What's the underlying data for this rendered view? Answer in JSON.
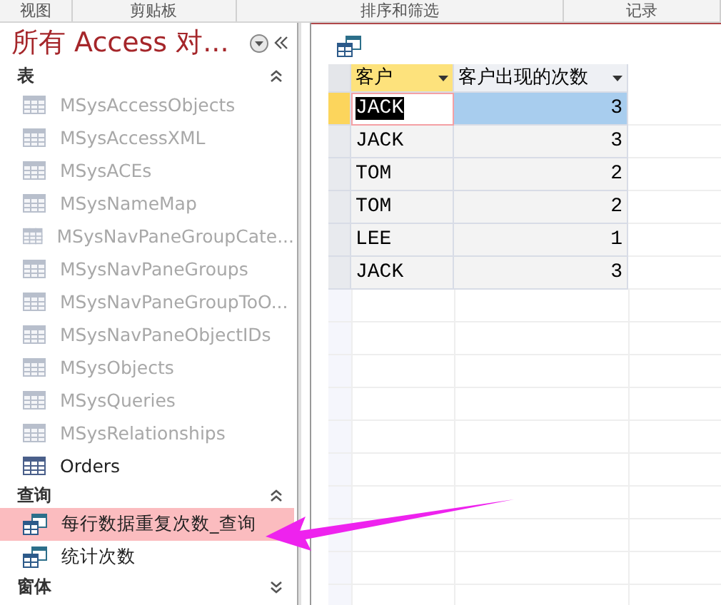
{
  "ribbon_groups": [
    "视图",
    "剪贴板",
    "排序和筛选",
    "记录"
  ],
  "nav_pane": {
    "title": "所有 Access 对...",
    "sections": [
      {
        "label": "表",
        "expanded": true,
        "items": [
          {
            "label": "MSysAccessObjects",
            "kind": "system",
            "selected": false
          },
          {
            "label": "MSysAccessXML",
            "kind": "system",
            "selected": false
          },
          {
            "label": "MSysACEs",
            "kind": "system",
            "selected": false
          },
          {
            "label": "MSysNameMap",
            "kind": "system",
            "selected": false
          },
          {
            "label": "MSysNavPaneGroupCate...",
            "kind": "system",
            "selected": false
          },
          {
            "label": "MSysNavPaneGroups",
            "kind": "system",
            "selected": false
          },
          {
            "label": "MSysNavPaneGroupToO...",
            "kind": "system",
            "selected": false
          },
          {
            "label": "MSysNavPaneObjectIDs",
            "kind": "system",
            "selected": false
          },
          {
            "label": "MSysObjects",
            "kind": "system",
            "selected": false
          },
          {
            "label": "MSysQueries",
            "kind": "system",
            "selected": false
          },
          {
            "label": "MSysRelationships",
            "kind": "system",
            "selected": false
          },
          {
            "label": "Orders",
            "kind": "table",
            "selected": false
          }
        ]
      },
      {
        "label": "查询",
        "expanded": true,
        "items": [
          {
            "label": "每行数据重复次数_查询",
            "kind": "query",
            "selected": true
          },
          {
            "label": "统计次数",
            "kind": "query",
            "selected": false
          }
        ]
      },
      {
        "label": "窗体",
        "expanded": false
      }
    ]
  },
  "datasheet": {
    "columns": [
      {
        "label": "客户",
        "selected": true
      },
      {
        "label": "客户出现的次数",
        "selected": false
      }
    ],
    "rows": [
      {
        "cells": [
          "JACK",
          "3"
        ],
        "selected": true
      },
      {
        "cells": [
          "JACK",
          "3"
        ],
        "selected": false
      },
      {
        "cells": [
          "TOM",
          "2"
        ],
        "selected": false
      },
      {
        "cells": [
          "TOM",
          "2"
        ],
        "selected": false
      },
      {
        "cells": [
          "LEE",
          "1"
        ],
        "selected": false
      },
      {
        "cells": [
          "JACK",
          "3"
        ],
        "selected": false
      }
    ]
  }
}
